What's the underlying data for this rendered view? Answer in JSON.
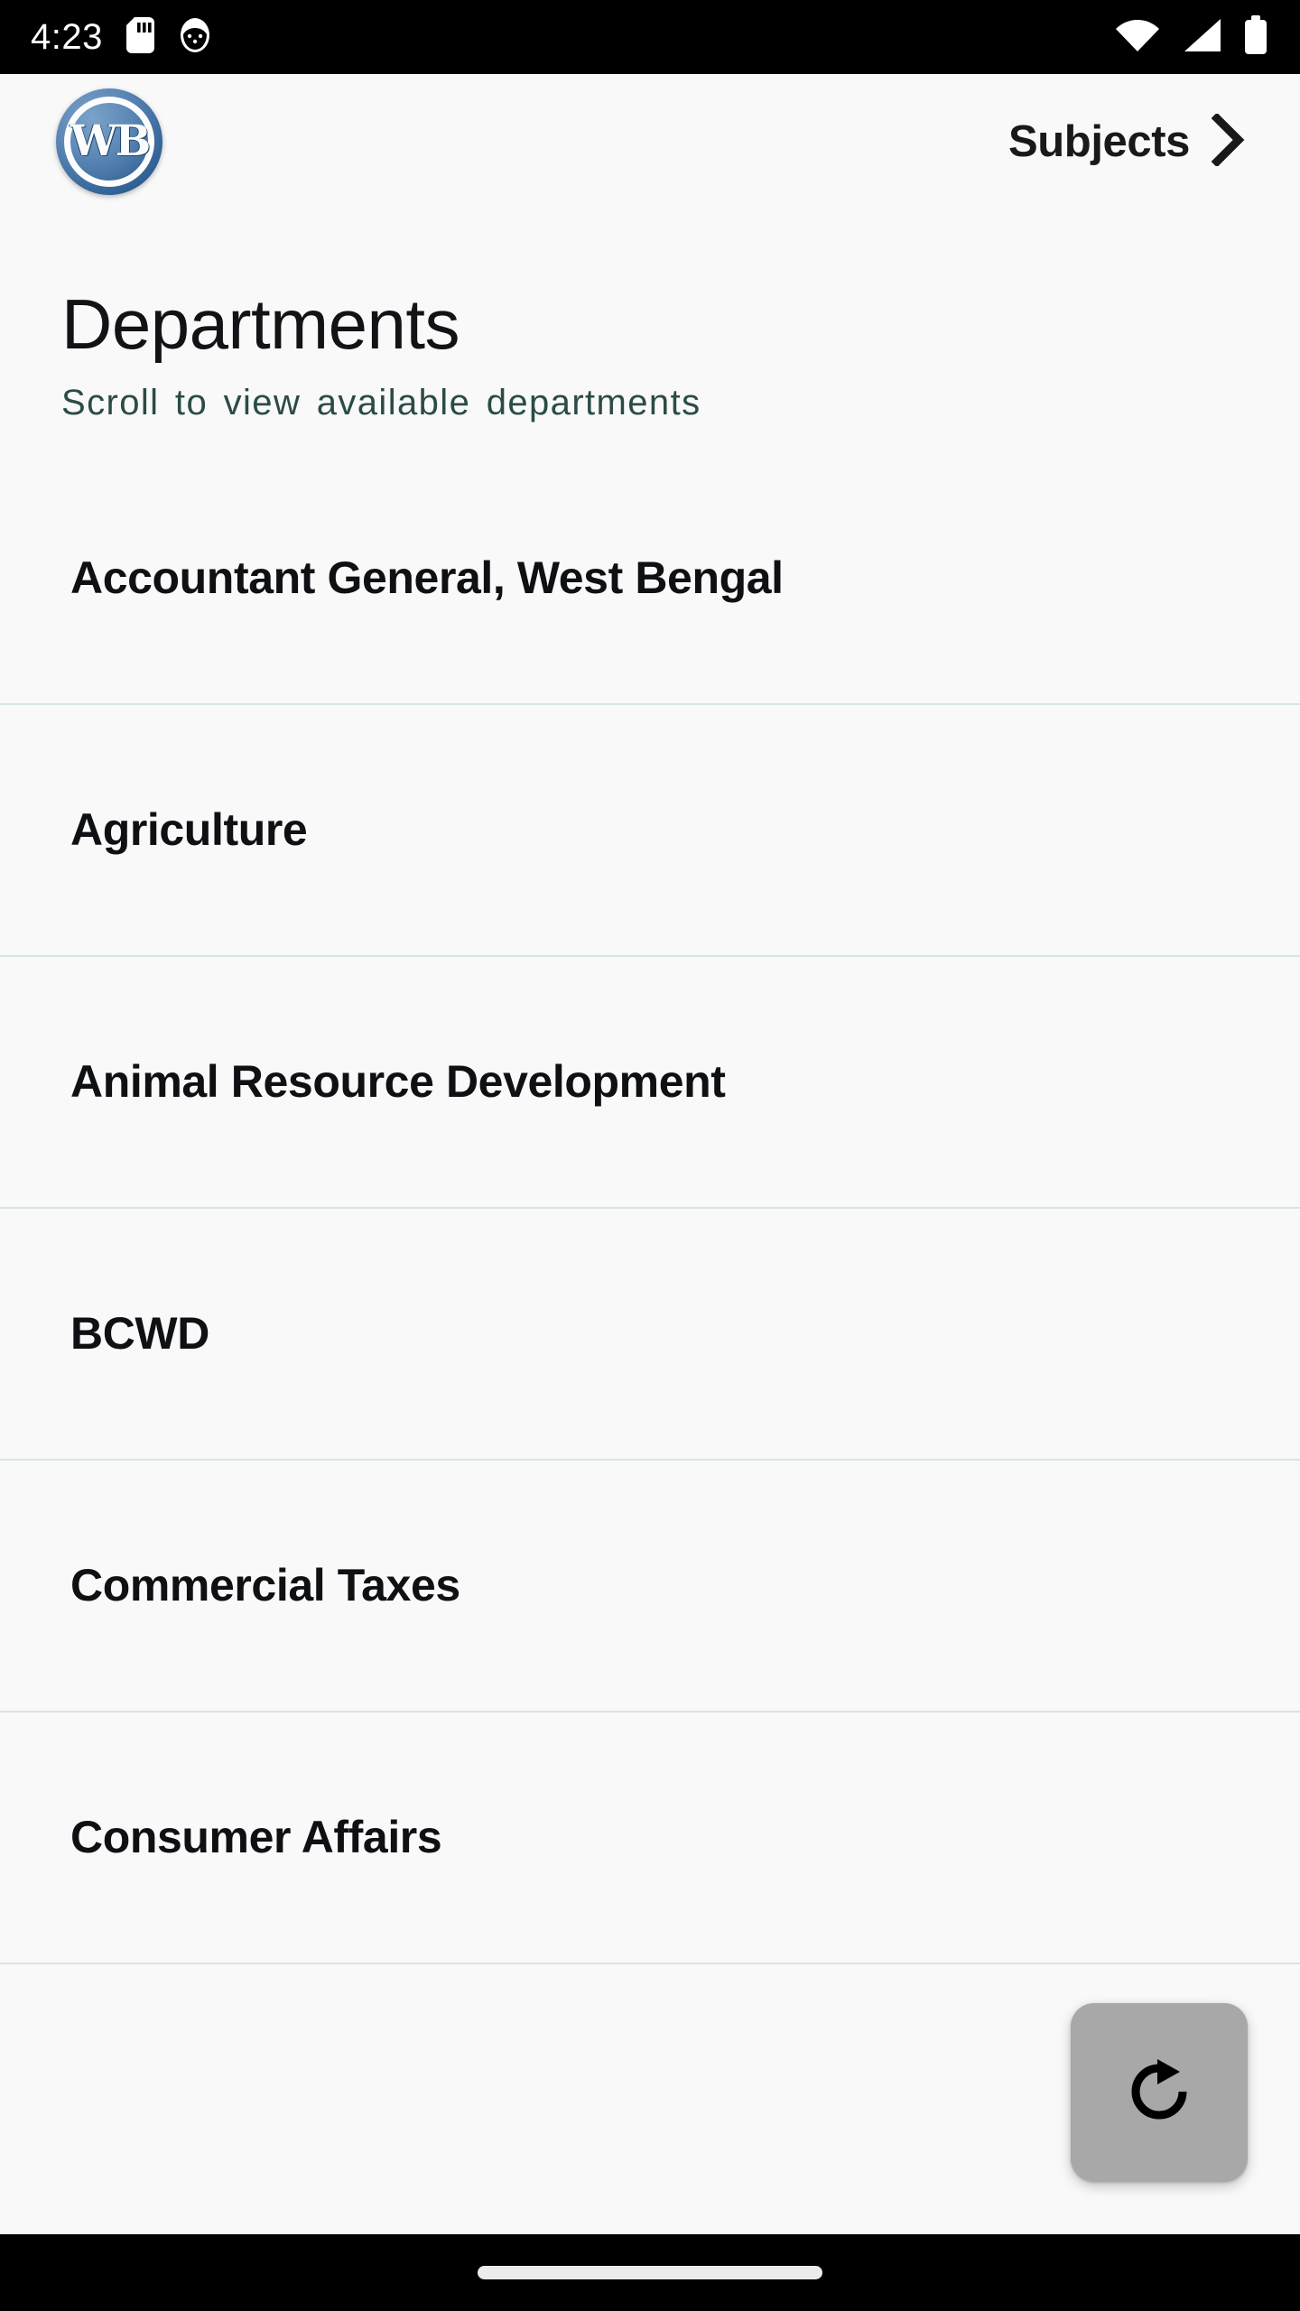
{
  "status_bar": {
    "time": "4:23",
    "left_icons": [
      "sd-card-icon",
      "app-notification-icon"
    ],
    "right_icons": [
      "wifi-icon",
      "cellular-signal-icon",
      "battery-icon"
    ],
    "background_color": "#000000",
    "foreground_color": "#ffffff"
  },
  "header": {
    "logo_text": "WB",
    "logo_name": "west-bengal-emblem-logo",
    "logo_color": "#2e5f93",
    "subjects_label": "Subjects",
    "chevron_icon": "chevron-right-icon"
  },
  "page": {
    "title": "Departments",
    "subtitle": "Scroll to view available departments",
    "subtitle_color": "#2b4b46",
    "background_color": "#f9f9f9"
  },
  "departments": [
    {
      "name": "Accountant General, West Bengal"
    },
    {
      "name": "Agriculture"
    },
    {
      "name": "Animal Resource Development"
    },
    {
      "name": "BCWD"
    },
    {
      "name": "Commercial Taxes"
    },
    {
      "name": "Consumer Affairs"
    }
  ],
  "fab": {
    "icon": "refresh-icon",
    "label": "Refresh",
    "background_color": "#a8a8a8",
    "icon_color": "#000000"
  },
  "nav_bar": {
    "gesture_pill": "home-gesture-pill",
    "background_color": "#000000"
  }
}
